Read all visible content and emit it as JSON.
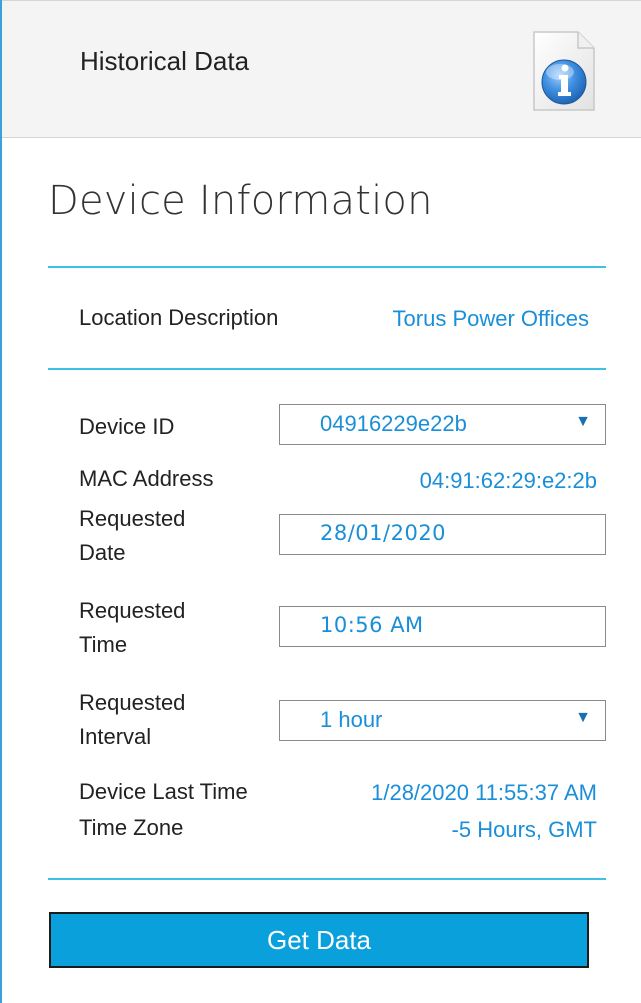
{
  "header": {
    "title": "Historical Data",
    "info_icon": "info-document-icon"
  },
  "section": {
    "title": "Device Information"
  },
  "location": {
    "label": "Location Description",
    "value": "Torus Power Offices"
  },
  "form": {
    "device_id": {
      "label": "Device ID",
      "value": "04916229e22b"
    },
    "mac_address": {
      "label": "MAC Address",
      "value": "04:91:62:29:e2:2b"
    },
    "requested_date": {
      "label_line1": "Requested",
      "label_line2": "Date",
      "value": "28/01/2020"
    },
    "requested_time": {
      "label_line1": "Requested",
      "label_line2": "Time",
      "value": "10:56 AM"
    },
    "requested_interval": {
      "label_line1": "Requested",
      "label_line2": "Interval",
      "value": "1 hour"
    },
    "device_last_time": {
      "label": "Device Last Time",
      "value": "1/28/2020 11:55:37 AM"
    },
    "time_zone": {
      "label": "Time Zone",
      "value": "-5 Hours, GMT"
    }
  },
  "actions": {
    "get_data_label": "Get Data"
  },
  "colors": {
    "accent": "#3ec1e3",
    "link_blue": "#1a8fd8",
    "button_blue": "#0aa0dc"
  }
}
